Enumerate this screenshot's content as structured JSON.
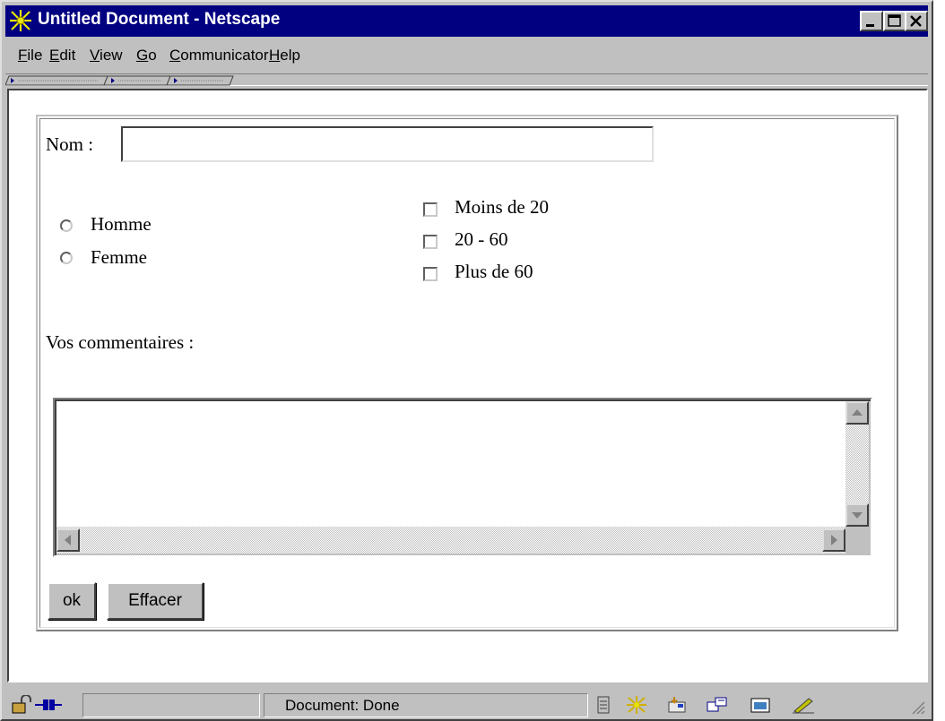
{
  "window": {
    "title": "Untitled Document - Netscape"
  },
  "menubar": {
    "items": [
      {
        "accel": "F",
        "rest": "ile"
      },
      {
        "accel": "E",
        "rest": "dit"
      },
      {
        "accel": "V",
        "rest": "iew"
      },
      {
        "accel": "G",
        "rest": "o"
      },
      {
        "accel": "C",
        "rest": "ommunicator"
      },
      {
        "accel": "H",
        "rest": "elp"
      }
    ]
  },
  "form": {
    "nom_label": "Nom :",
    "nom_value": "",
    "gender": [
      {
        "label": "Homme",
        "checked": false
      },
      {
        "label": "Femme",
        "checked": false
      }
    ],
    "age": [
      {
        "label": "Moins de 20",
        "checked": false
      },
      {
        "label": "20 - 60",
        "checked": false
      },
      {
        "label": "Plus de 60",
        "checked": false
      }
    ],
    "comments_label": "Vos commentaires :",
    "comments_value": "",
    "ok_label": "ok",
    "reset_label": "Effacer"
  },
  "statusbar": {
    "text": "Document: Done",
    "icons": [
      "security-lock-icon",
      "connection-plug-icon",
      "component-bar-icon",
      "navigator-icon",
      "mail-icon",
      "discussions-icon",
      "composer-icon",
      "edit-pen-icon"
    ]
  },
  "colors": {
    "titlebar": "#000080",
    "chrome": "#c0c0c0",
    "content": "#ffffff"
  }
}
